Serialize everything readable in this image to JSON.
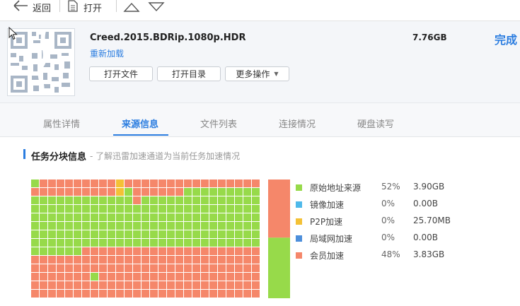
{
  "toolbar": {
    "back_label": "返回",
    "open_label": "打开"
  },
  "task": {
    "filename": "Creed.2015.BDRip.1080p.HDR",
    "reload_label": "重新加载",
    "size": "7.76GB",
    "status": "完成",
    "open_file_label": "打开文件",
    "open_dir_label": "打开目录",
    "more_label": "更多操作"
  },
  "tabs": [
    {
      "label": "属性详情"
    },
    {
      "label": "来源信息"
    },
    {
      "label": "文件列表"
    },
    {
      "label": "连接情况"
    },
    {
      "label": "硬盘读写"
    }
  ],
  "active_tab": "来源信息",
  "section": {
    "title": "任务分块信息",
    "subtitle": "- 了解迅雷加速通道为当前任务加速情况"
  },
  "colors": {
    "origin": "#97da4a",
    "mirror": "#4fb9ea",
    "p2p": "#f4c136",
    "lan": "#4d8fdb",
    "vip": "#f5876a",
    "accent": "#2b7de0"
  },
  "legend": [
    {
      "name": "原始地址来源",
      "pct": "52%",
      "value": "3.90GB",
      "color_key": "origin"
    },
    {
      "name": "镜像加速",
      "pct": "0%",
      "value": "0.00B",
      "color_key": "mirror"
    },
    {
      "name": "P2P加速",
      "pct": "0%",
      "value": "25.70MB",
      "color_key": "p2p"
    },
    {
      "name": "局域网加速",
      "pct": "0%",
      "value": "0.00B",
      "color_key": "lan"
    },
    {
      "name": "会员加速",
      "pct": "48%",
      "value": "3.83GB",
      "color_key": "vip"
    }
  ],
  "chart_data": {
    "type": "heatmap",
    "cols": 27,
    "rows": 14,
    "key": {
      "G": "origin",
      "O": "vip",
      "Y": "p2p"
    },
    "cells": [
      "GOOOOOOOOOYOOOOOOOOOOOOOOOO",
      "OOOOOOOOOOYGOOOOOOGGGGGGGGG",
      "GGGGGGGGGGGGOGGGGGGGGGGGGGG",
      "GGGGGGGGGGGGGGGGGGGGGGGGGGG",
      "GGGGGGGGGGGGGGGGGGGGGGGGGGG",
      "GGGGGGGGGGGGGGGGGGGGGGGGGGG",
      "GGGGGGGGGGGGGGGGGGGGGGGGGGG",
      "GGGGGGGGGGGGGGGGGGGGGGGGGGG",
      "GGGGGGOOOOOOOOOOOOOOOOOOOOO",
      "OOOOOOOOOOOOOOOOOOOOOOOOOOO",
      "OOOOOOOOOOOOOOOOOOOOOOOOOOO",
      "OOOOOOOGOOOOOOOOOOOOOOOOOOO",
      "OOOOOOOOOOOOOOOOOOOOOOOOOOO",
      "OOOOOOOOOOOOOOOOOOOOOOOOOOO"
    ],
    "bar": [
      {
        "key": "vip",
        "fraction": 0.49
      },
      {
        "key": "origin",
        "fraction": 0.51
      }
    ]
  }
}
